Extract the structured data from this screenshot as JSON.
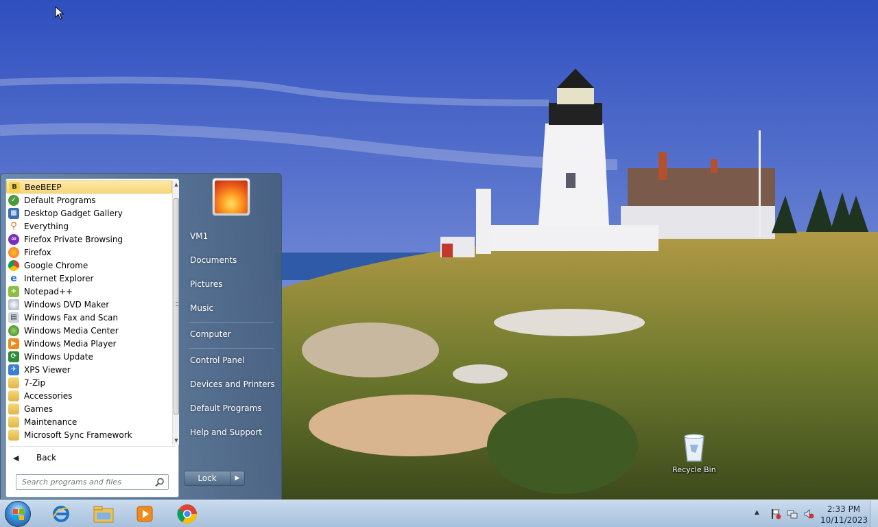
{
  "desktop": {
    "recycle_bin_label": "Recycle Bin"
  },
  "start_menu": {
    "programs": [
      {
        "label": "BeeBEEP",
        "icon": "beebeep-icon",
        "selected": true
      },
      {
        "label": "Default Programs",
        "icon": "default-programs-icon"
      },
      {
        "label": "Desktop Gadget Gallery",
        "icon": "gadget-gallery-icon"
      },
      {
        "label": "Everything",
        "icon": "everything-search-icon"
      },
      {
        "label": "Firefox Private Browsing",
        "icon": "firefox-private-icon"
      },
      {
        "label": "Firefox",
        "icon": "firefox-icon"
      },
      {
        "label": "Google Chrome",
        "icon": "chrome-icon"
      },
      {
        "label": "Internet Explorer",
        "icon": "internet-explorer-icon"
      },
      {
        "label": "Notepad++",
        "icon": "notepad-plus-plus-icon"
      },
      {
        "label": "Windows DVD Maker",
        "icon": "dvd-maker-icon"
      },
      {
        "label": "Windows Fax and Scan",
        "icon": "fax-scan-icon"
      },
      {
        "label": "Windows Media Center",
        "icon": "media-center-icon"
      },
      {
        "label": "Windows Media Player",
        "icon": "media-player-icon"
      },
      {
        "label": "Windows Update",
        "icon": "windows-update-icon"
      },
      {
        "label": "XPS Viewer",
        "icon": "xps-viewer-icon"
      },
      {
        "label": "7-Zip",
        "icon": "folder-icon"
      },
      {
        "label": "Accessories",
        "icon": "folder-icon"
      },
      {
        "label": "Games",
        "icon": "folder-icon"
      },
      {
        "label": "Maintenance",
        "icon": "folder-icon"
      },
      {
        "label": "Microsoft Sync Framework",
        "icon": "folder-icon"
      }
    ],
    "back_label": "Back",
    "search_placeholder": "Search programs and files",
    "places": {
      "user": "VM1",
      "documents": "Documents",
      "pictures": "Pictures",
      "music": "Music",
      "computer": "Computer",
      "control_panel": "Control Panel",
      "devices_printers": "Devices and Printers",
      "default_programs": "Default Programs",
      "help_support": "Help and Support"
    },
    "shutdown_label": "Lock"
  },
  "taskbar": {
    "pinned": [
      "internet-explorer-icon",
      "windows-explorer-icon",
      "media-player-icon",
      "chrome-icon"
    ],
    "clock_time": "2:33 PM",
    "clock_date": "10/11/2023"
  },
  "colors": {
    "selected_item": "#f7d77a",
    "taskbar": "#b6cde6",
    "sky": "#3a5bbf"
  }
}
